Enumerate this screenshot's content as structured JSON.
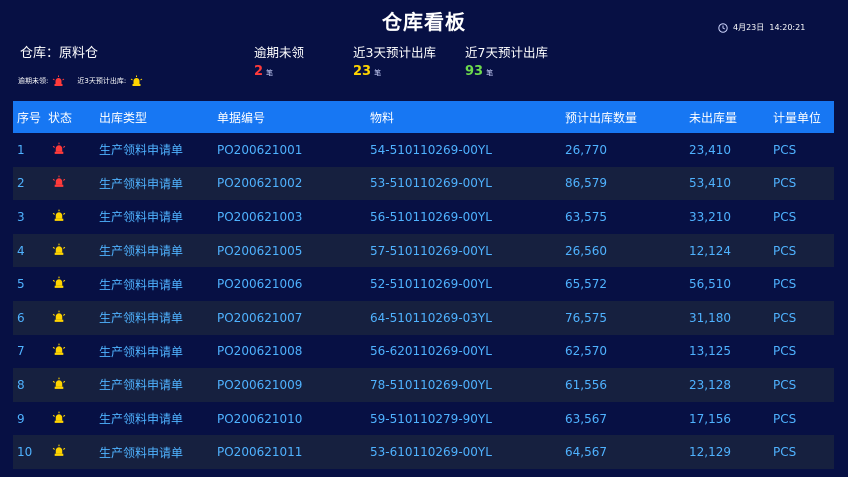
{
  "header": {
    "title": "仓库看板",
    "datetime": "4月23日  14:20:21",
    "warehouse": "仓库：原料仓"
  },
  "stats": [
    {
      "label": "逾期未领",
      "value": "2",
      "unit": "笔",
      "color": "#ff3b3b"
    },
    {
      "label": "近3天预计出库",
      "value": "23",
      "unit": "笔",
      "color": "#ffd400"
    },
    {
      "label": "近7天预计出库",
      "value": "93",
      "unit": "笔",
      "color": "#6ddb4d"
    }
  ],
  "legend": {
    "overdue_label": "逾期未领:",
    "overdue_icon": "red-alarm-icon",
    "soon_label": "近3天预计出库:",
    "soon_icon": "yellow-alarm-icon"
  },
  "table": {
    "headers": [
      "序号",
      "状态",
      "出库类型",
      "单据编号",
      "物料",
      "预计出库数量",
      "未出库量",
      "计量单位"
    ],
    "rows": [
      {
        "no": "1",
        "status": "red",
        "type": "生产领料申请单",
        "doc": "PO200621001",
        "material": "54-510110269-00YL",
        "planned": "26,770",
        "remaining": "23,410",
        "unit": "PCS"
      },
      {
        "no": "2",
        "status": "red",
        "type": "生产领料申请单",
        "doc": "PO200621002",
        "material": "53-510110269-00YL",
        "planned": "86,579",
        "remaining": "53,410",
        "unit": "PCS"
      },
      {
        "no": "3",
        "status": "yellow",
        "type": "生产领料申请单",
        "doc": "PO200621003",
        "material": "56-510110269-00YL",
        "planned": "63,575",
        "remaining": "33,210",
        "unit": "PCS"
      },
      {
        "no": "4",
        "status": "yellow",
        "type": "生产领料申请单",
        "doc": "PO200621005",
        "material": "57-510110269-00YL",
        "planned": "26,560",
        "remaining": "12,124",
        "unit": "PCS"
      },
      {
        "no": "5",
        "status": "yellow",
        "type": "生产领料申请单",
        "doc": "PO200621006",
        "material": "52-510110269-00YL",
        "planned": "65,572",
        "remaining": "56,510",
        "unit": "PCS"
      },
      {
        "no": "6",
        "status": "yellow",
        "type": "生产领料申请单",
        "doc": "PO200621007",
        "material": "64-510110269-03YL",
        "planned": "76,575",
        "remaining": "31,180",
        "unit": "PCS"
      },
      {
        "no": "7",
        "status": "yellow",
        "type": "生产领料申请单",
        "doc": "PO200621008",
        "material": "56-620110269-00YL",
        "planned": "62,570",
        "remaining": "13,125",
        "unit": "PCS"
      },
      {
        "no": "8",
        "status": "yellow",
        "type": "生产领料申请单",
        "doc": "PO200621009",
        "material": "78-510110269-00YL",
        "planned": "61,556",
        "remaining": "23,128",
        "unit": "PCS"
      },
      {
        "no": "9",
        "status": "yellow",
        "type": "生产领料申请单",
        "doc": "PO200621010",
        "material": "59-510110279-90YL",
        "planned": "63,567",
        "remaining": "17,156",
        "unit": "PCS"
      },
      {
        "no": "10",
        "status": "yellow",
        "type": "生产领料申请单",
        "doc": "PO200621011",
        "material": "53-610110269-00YL",
        "planned": "64,567",
        "remaining": "12,129",
        "unit": "PCS"
      }
    ]
  }
}
